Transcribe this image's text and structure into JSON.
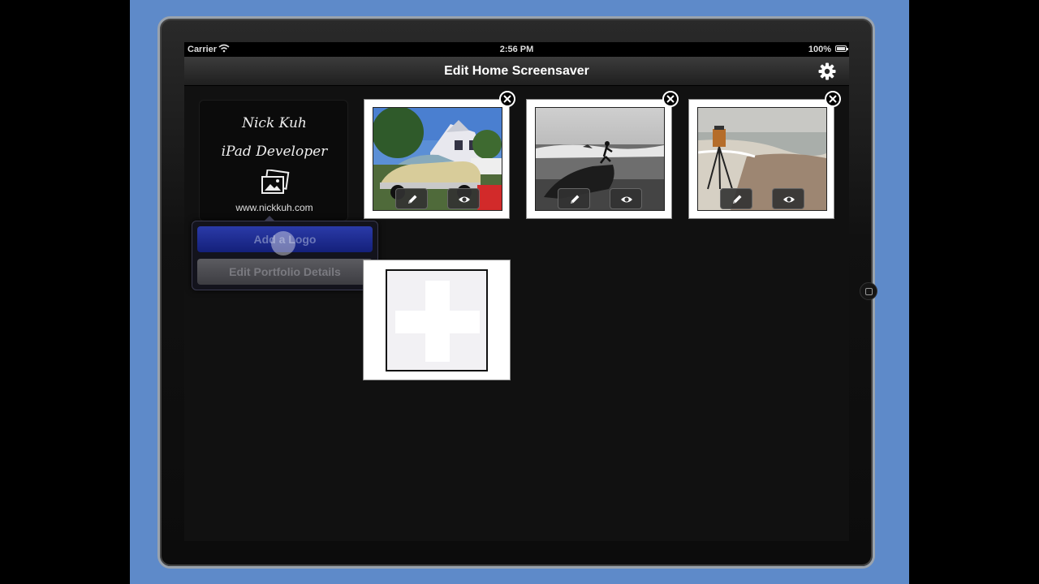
{
  "statusbar": {
    "carrier": "Carrier",
    "time": "2:56 PM",
    "battery": "100%"
  },
  "navbar": {
    "title": "Edit Home Screensaver",
    "settings_icon": "gear-icon"
  },
  "portfolio": {
    "name": "Nick Kuh",
    "role": "iPad Developer",
    "url": "www.nickkuh.com",
    "logo_icon": "photos-icon"
  },
  "popover": {
    "add_logo": "Add a Logo",
    "edit_details": "Edit Portfolio Details"
  },
  "photos": [
    {
      "subject": "classic car",
      "edit_icon": "pencil-icon",
      "view_icon": "eye-icon",
      "remove_icon": "close-icon"
    },
    {
      "subject": "person on rock by sea",
      "edit_icon": "pencil-icon",
      "view_icon": "eye-icon",
      "remove_icon": "close-icon"
    },
    {
      "subject": "easel on beach",
      "edit_icon": "pencil-icon",
      "view_icon": "eye-icon",
      "remove_icon": "close-icon"
    }
  ],
  "add_tile_icon": "plus-icon",
  "colors": {
    "background": "#5e8ac9",
    "screen": "#111111",
    "primary_button": "#1e2c90"
  }
}
